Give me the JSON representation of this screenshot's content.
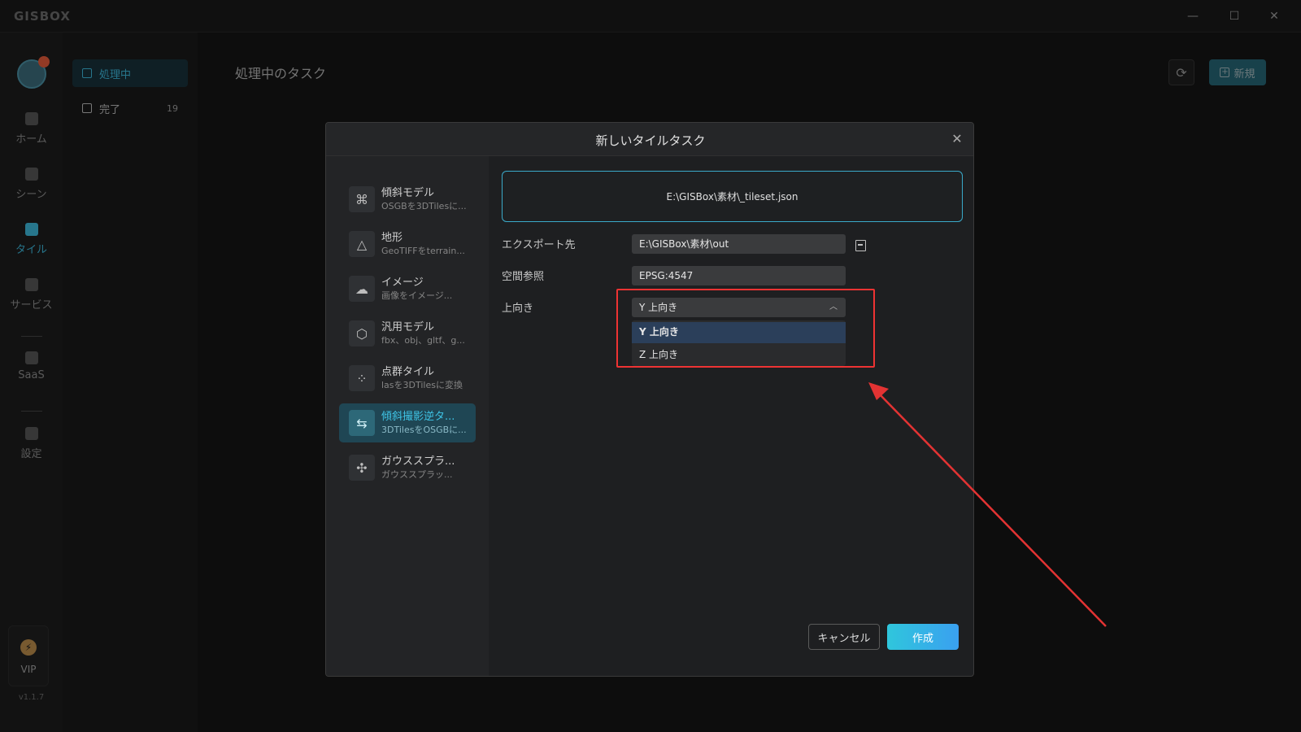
{
  "app": {
    "logo": "GISBOX",
    "version": "v1.1.7",
    "window_controls": [
      "minimize-icon",
      "maximize-icon",
      "close-icon"
    ]
  },
  "leftbar": {
    "items": [
      {
        "label": "ホーム",
        "icon": "home-icon"
      },
      {
        "label": "シーン",
        "icon": "scene-icon"
      },
      {
        "label": "タイル",
        "icon": "tile-icon",
        "active": true
      },
      {
        "label": "サービス",
        "icon": "service-icon"
      },
      {
        "label": "SaaS",
        "icon": "lock-icon"
      },
      {
        "label": "設定",
        "icon": "settings-icon"
      }
    ],
    "vip_label": "VIP"
  },
  "subnav": {
    "items": [
      {
        "label": "処理中",
        "active": true
      },
      {
        "label": "完了",
        "count": "19"
      }
    ]
  },
  "main": {
    "title": "処理中のタスク",
    "new_button": "新規"
  },
  "modal": {
    "title": "新しいタイルタスク",
    "tools": [
      {
        "name": "傾斜モデル",
        "desc": "OSGBを3DTilesに...",
        "icon": "⌘"
      },
      {
        "name": "地形",
        "desc": "GeoTIFFをterrain...",
        "icon": "△"
      },
      {
        "name": "イメージ",
        "desc": "画像をイメージ...",
        "icon": "☁"
      },
      {
        "name": "汎用モデル",
        "desc": "fbx、obj、gltf、g...",
        "icon": "⬡"
      },
      {
        "name": "点群タイル",
        "desc": "lasを3DTilesに変換",
        "icon": "⁘"
      },
      {
        "name": "傾斜撮影逆タ...",
        "desc": "3DTilesをOSGBに...",
        "icon": "⇆",
        "active": true
      },
      {
        "name": "ガウススプラ...",
        "desc": "ガウススプラッ...",
        "icon": "✣"
      }
    ],
    "file_path": "E:\\GISBox\\素材\\_tileset.json",
    "export_label": "エクスポート先",
    "export_value": "E:\\GISBox\\素材\\out",
    "srs_label": "空間参照",
    "srs_value": "EPSG:4547",
    "up_label": "上向き",
    "up_selected": "Y 上向き",
    "up_options": [
      "Y 上向き",
      "Z 上向き"
    ],
    "cancel_label": "キャンセル",
    "create_label": "作成"
  },
  "annotation_color": "#e33333"
}
